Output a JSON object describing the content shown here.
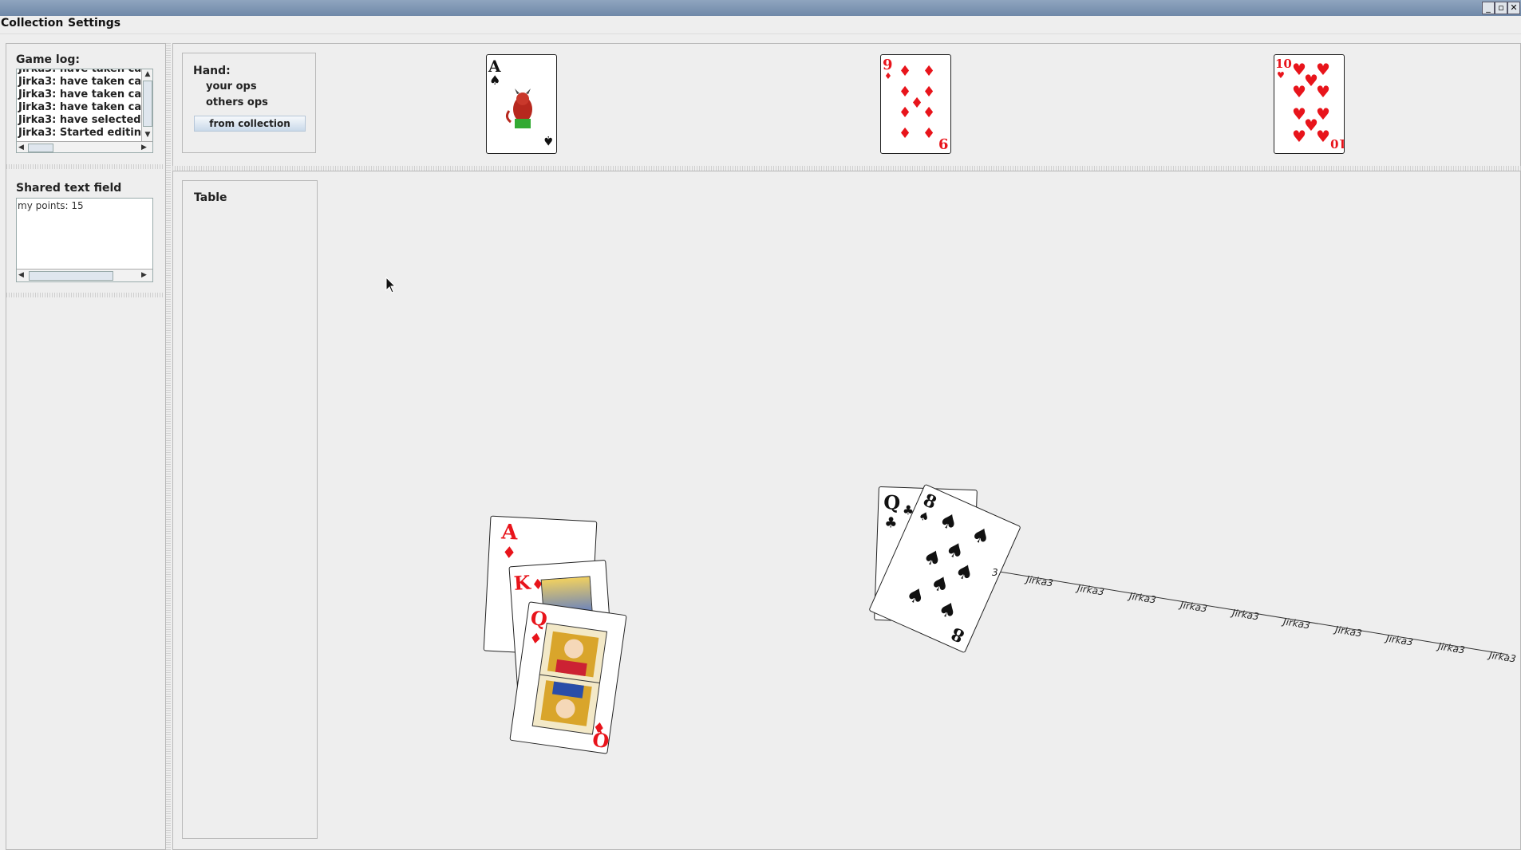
{
  "window": {
    "controls": [
      "minimize",
      "maximize",
      "close"
    ]
  },
  "menu": {
    "collection": "Collection",
    "settings": "Settings"
  },
  "sidebar": {
    "game_log_label": "Game log:",
    "game_log_lines": [
      "Jirka3:  have taken ca",
      "Jirka3:  have taken ca",
      "Jirka3:  have taken ca",
      "Jirka3:  have taken ca",
      "Jirka3:  have selected",
      "Jirka3: Started editin"
    ],
    "shared_text_label": "Shared text field",
    "shared_text_value": "my points: 15"
  },
  "hand": {
    "label": "Hand:",
    "your_ops": "your ops",
    "others_ops": "others ops",
    "from_collection": "from collection",
    "cards": [
      {
        "rank": "A",
        "suit": "spades"
      },
      {
        "rank": "9",
        "suit": "diamonds"
      },
      {
        "rank": "10",
        "suit": "hearts"
      }
    ]
  },
  "table": {
    "label": "Table",
    "stack_left": [
      {
        "rank": "A",
        "suit": "diamonds"
      },
      {
        "rank": "K",
        "suit": "diamonds"
      },
      {
        "rank": "Q",
        "suit": "diamonds"
      }
    ],
    "stack_right": [
      {
        "rank": "Q",
        "suit": "clubs"
      },
      {
        "rank": "8",
        "suit": "spades"
      }
    ],
    "trail_labels": [
      "Jirka3",
      "Jirka3",
      "Jirka3",
      "Jirka3",
      "Jirka3",
      "Jirka3",
      "Jirka3",
      "Jirka3",
      "Jirka3",
      "Jirka3"
    ],
    "trail_partial": "3"
  },
  "icons": {
    "suit_spade": "♠",
    "suit_diamond": "♦",
    "suit_heart": "♥",
    "suit_club": "♣",
    "cursor": "mouse-pointer-icon"
  },
  "colors": {
    "red_suit": "#e8141b",
    "black_suit": "#111111",
    "titlebar": "#7f96b3"
  }
}
